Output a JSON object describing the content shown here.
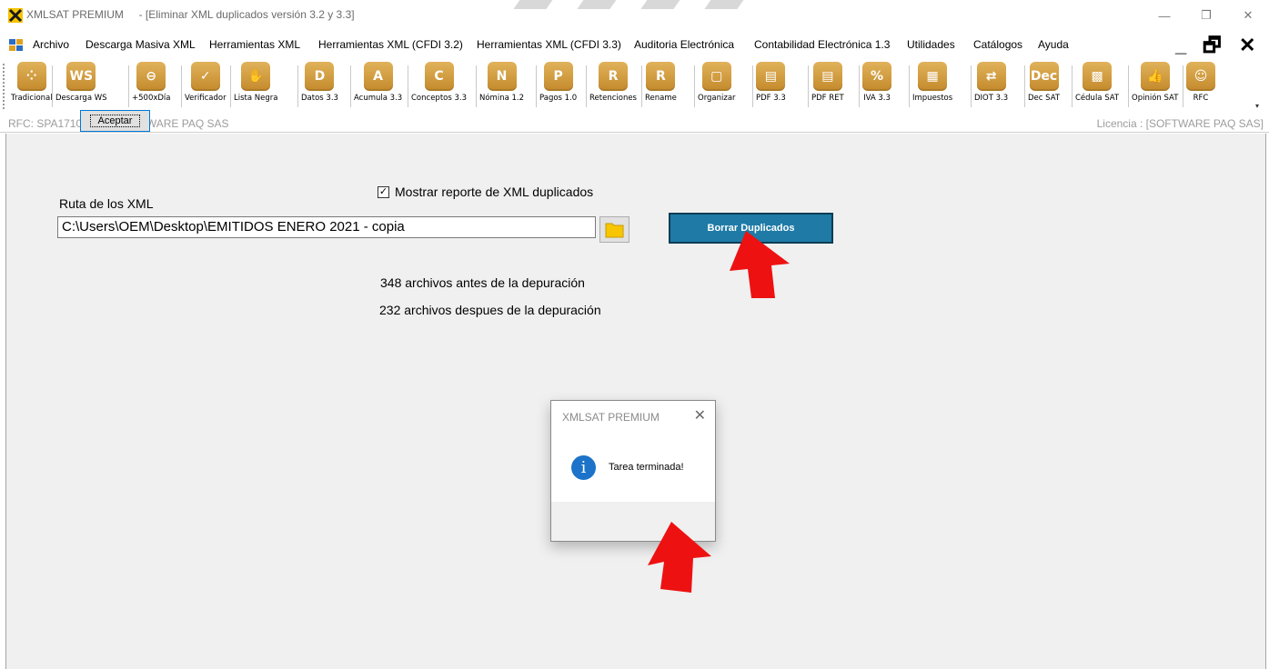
{
  "window": {
    "app_name": "XMLSAT PREMIUM",
    "doc_title": "- [Eliminar XML duplicados versión 3.2 y 3.3]",
    "controls": {
      "minimize": "—",
      "restore": "❐",
      "close": "✕"
    }
  },
  "menu": {
    "items": [
      "Archivo",
      "Descarga Masiva XML",
      "Herramientas XML",
      "Herramientas XML (CFDI 3.2)",
      "Herramientas XML (CFDI 3.3)",
      "Auditoria Electrónica",
      "Contabilidad Electrónica 1.3",
      "Utilidades",
      "Catálogos",
      "Ayuda"
    ],
    "mdi_controls": {
      "minimize": "_",
      "restore": "🗗",
      "close": "✕"
    }
  },
  "toolbar": {
    "buttons": [
      {
        "label": "Tradicional",
        "glyph": "⁘",
        "icon": "grid-icon"
      },
      {
        "label": "Descarga WS",
        "glyph": "WS",
        "icon": "ws-icon"
      },
      {
        "label": "+500xDía",
        "glyph": "⊖",
        "icon": "toggle-icon"
      },
      {
        "label": "Verificador",
        "glyph": "✓",
        "icon": "check-icon"
      },
      {
        "label": "Lista Negra",
        "glyph": "✋",
        "icon": "hand-icon"
      },
      {
        "label": "Datos 3.3",
        "glyph": "D",
        "icon": "datos-icon"
      },
      {
        "label": "Acumula 3.3",
        "glyph": "A",
        "icon": "acumula-icon"
      },
      {
        "label": "Conceptos 3.3",
        "glyph": "C",
        "icon": "conceptos-icon"
      },
      {
        "label": "Nómina 1.2",
        "glyph": "N",
        "icon": "nomina-icon"
      },
      {
        "label": "Pagos 1.0",
        "glyph": "P",
        "icon": "pagos-icon"
      },
      {
        "label": "Retenciones",
        "glyph": "R",
        "icon": "retenciones-icon"
      },
      {
        "label": "Rename",
        "glyph": "R",
        "icon": "rename-icon"
      },
      {
        "label": "Organizar",
        "glyph": "▢",
        "icon": "organizar-icon"
      },
      {
        "label": "PDF 3.3",
        "glyph": "▤",
        "icon": "pdf-icon"
      },
      {
        "label": "PDF RET",
        "glyph": "▤",
        "icon": "pdf-ret-icon"
      },
      {
        "label": "IVA 3.3",
        "glyph": "%",
        "icon": "percent-icon"
      },
      {
        "label": "Impuestos",
        "glyph": "▦",
        "icon": "calculator-icon"
      },
      {
        "label": "DIOT 3.3",
        "glyph": "⇄",
        "icon": "handshake-icon"
      },
      {
        "label": "Dec SAT",
        "glyph": "Dec",
        "icon": "dec-icon"
      },
      {
        "label": "Cédula SAT",
        "glyph": "▩",
        "icon": "qr-icon"
      },
      {
        "label": "Opinión SAT",
        "glyph": "👍",
        "icon": "thumbs-up-icon"
      },
      {
        "label": "RFC",
        "glyph": "☺",
        "icon": "rfc-icon"
      }
    ]
  },
  "status": {
    "rfc": "RFC: SPA1710063C9 SOFTWARE PAQ SAS",
    "license": "Licencia : [SOFTWARE PAQ SAS]"
  },
  "form": {
    "checkbox_label": "Mostrar reporte de XML duplicados",
    "checkbox_checked": true,
    "path_label": "Ruta de los XML",
    "path_value": "C:\\Users\\OEM\\Desktop\\EMITIDOS ENERO 2021 - copia",
    "delete_button": "Borrar Duplicados",
    "before_text": "348 archivos antes de la depuración",
    "after_text": "232 archivos despues de la depuración"
  },
  "dialog": {
    "title": "XMLSAT PREMIUM",
    "close": "✕",
    "info_glyph": "i",
    "message": "Tarea terminada!",
    "ok_button": "Aceptar"
  },
  "colors": {
    "accent_button": "#1f7aa6",
    "toolbar_gold": "#c48a2c",
    "info_blue": "#1c73c9",
    "annotation_arrow": "#ee1111"
  }
}
